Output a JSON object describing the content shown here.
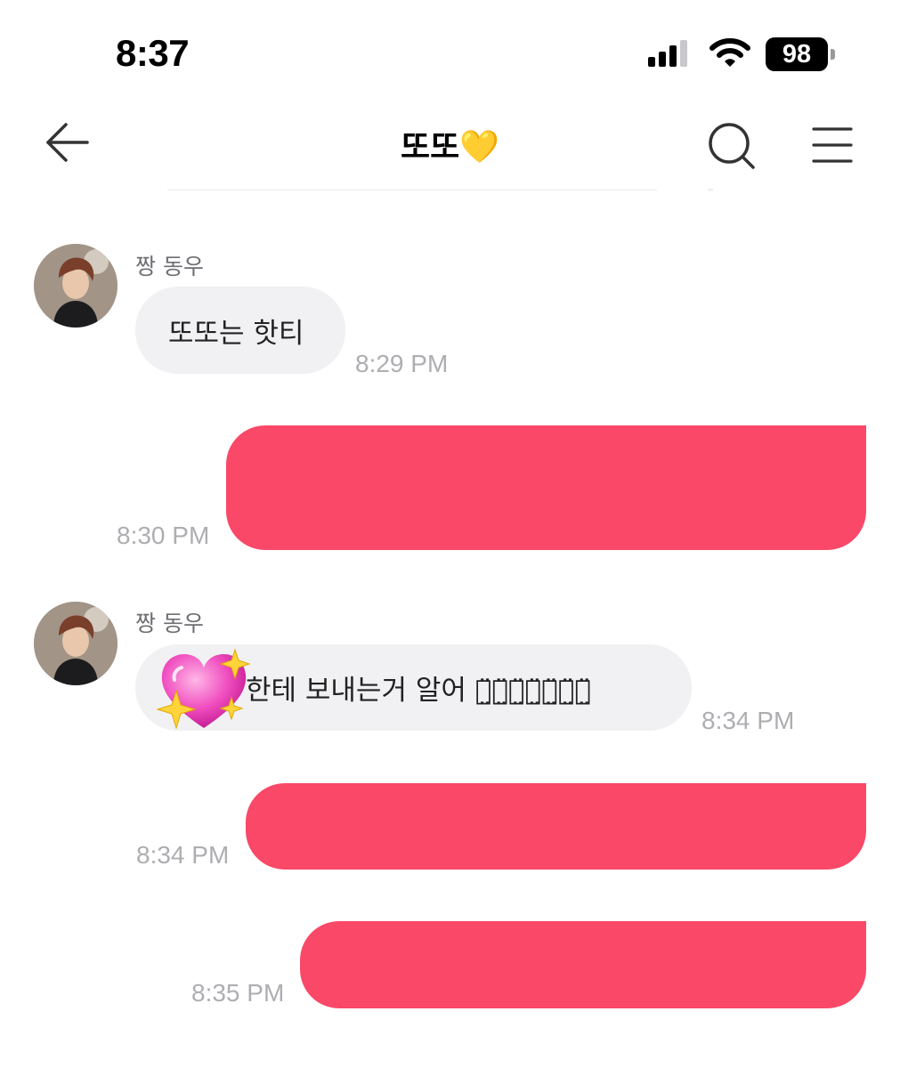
{
  "status_bar": {
    "time": "8:37",
    "battery": "98"
  },
  "header": {
    "title": "또또",
    "title_emoji": "💛"
  },
  "messages": [
    {
      "direction": "incoming",
      "sender": "짱 동우",
      "text": "또또는 핫티",
      "time": "8:29 PM"
    },
    {
      "direction": "outgoing",
      "text": "",
      "time": "8:30 PM"
    },
    {
      "direction": "incoming",
      "sender": "짱 동우",
      "emoji": "sparkling-heart",
      "text": "한테 보내는거 알어 ㅋ̤̈ㅋ̤̈ㅋ̤̈ㅋ̤̈ㅋ̤̈ㅋ̤̈ㅋ̤̈",
      "time": "8:34 PM"
    },
    {
      "direction": "outgoing",
      "text": "",
      "time": "8:34 PM"
    },
    {
      "direction": "outgoing",
      "text": "",
      "time": "8:35 PM"
    }
  ],
  "colors": {
    "outgoing_bubble": "#fa4868",
    "incoming_bubble": "#f1f1f3",
    "timestamp": "#aeaeb2",
    "sender_name": "#6d6d72"
  }
}
